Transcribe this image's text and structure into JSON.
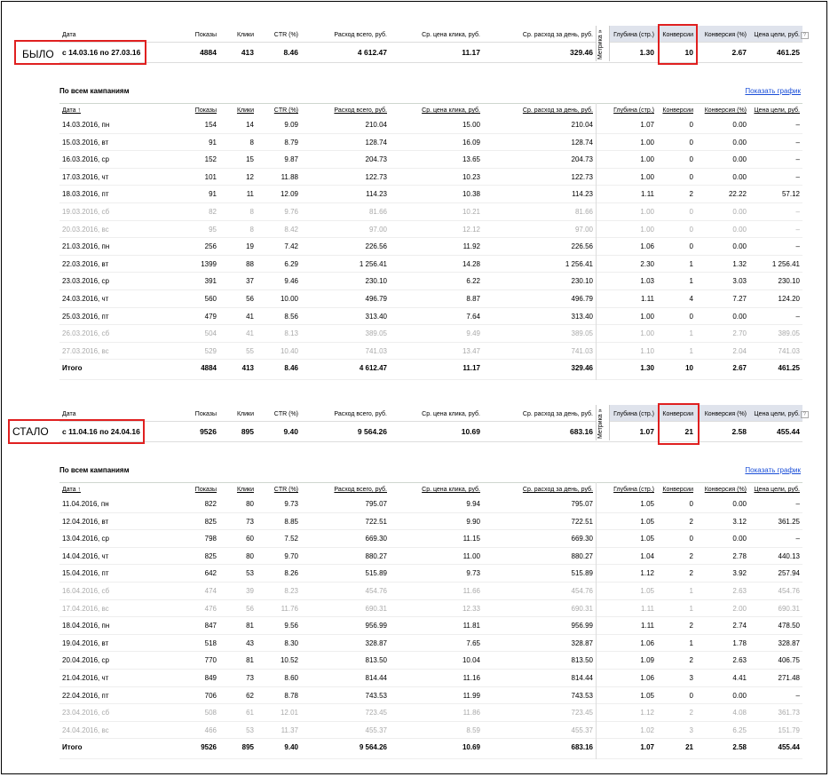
{
  "labels": {
    "before": "БЫЛО",
    "after": "СТАЛО"
  },
  "summary_headers": {
    "date": "Дата",
    "shows": "Показы",
    "clicks": "Клики",
    "ctr": "CTR (%)",
    "spend": "Расход всего, руб.",
    "cpc": "Ср. цена клика, руб.",
    "daily": "Ср. расход за день, руб.",
    "metrika": "Метрика »",
    "depth": "Глубина (стр.)",
    "conv": "Конверсии",
    "conv_pct": "Конверсия (%)",
    "goal_price": "Цена цели, руб.",
    "help": "?"
  },
  "table_headers": {
    "date": "Дата ↑",
    "shows": "Показы",
    "clicks": "Клики",
    "ctr": "CTR (%)",
    "spend": "Расход всего, руб.",
    "cpc": "Ср. цена клика, руб.",
    "daily": "Ср. расход за день, руб.",
    "depth": "Глубина (стр.)",
    "conv": "Конверсии",
    "conv_pct": "Конверсия (%)",
    "goal_price": "Цена цели, руб."
  },
  "section_title": "По всем кампаниям",
  "show_graph": "Показать график",
  "total_label": "Итого",
  "before": {
    "summary": {
      "period": "с 14.03.16 по 27.03.16",
      "shows": "4884",
      "clicks": "413",
      "ctr": "8.46",
      "spend": "4 612.47",
      "cpc": "11.17",
      "daily": "329.46",
      "depth": "1.30",
      "conv": "10",
      "conv_pct": "2.67",
      "goal_price": "461.25"
    },
    "rows": [
      [
        "14.03.2016, пн",
        "154",
        "14",
        "9.09",
        "210.04",
        "15.00",
        "210.04",
        "1.07",
        "0",
        "0.00",
        "–",
        false
      ],
      [
        "15.03.2016, вт",
        "91",
        "8",
        "8.79",
        "128.74",
        "16.09",
        "128.74",
        "1.00",
        "0",
        "0.00",
        "–",
        false
      ],
      [
        "16.03.2016, ср",
        "152",
        "15",
        "9.87",
        "204.73",
        "13.65",
        "204.73",
        "1.00",
        "0",
        "0.00",
        "–",
        false
      ],
      [
        "17.03.2016, чт",
        "101",
        "12",
        "11.88",
        "122.73",
        "10.23",
        "122.73",
        "1.00",
        "0",
        "0.00",
        "–",
        false
      ],
      [
        "18.03.2016, пт",
        "91",
        "11",
        "12.09",
        "114.23",
        "10.38",
        "114.23",
        "1.11",
        "2",
        "22.22",
        "57.12",
        false
      ],
      [
        "19.03.2016, сб",
        "82",
        "8",
        "9.76",
        "81.66",
        "10.21",
        "81.66",
        "1.00",
        "0",
        "0.00",
        "–",
        true
      ],
      [
        "20.03.2016, вс",
        "95",
        "8",
        "8.42",
        "97.00",
        "12.12",
        "97.00",
        "1.00",
        "0",
        "0.00",
        "–",
        true
      ],
      [
        "21.03.2016, пн",
        "256",
        "19",
        "7.42",
        "226.56",
        "11.92",
        "226.56",
        "1.06",
        "0",
        "0.00",
        "–",
        false
      ],
      [
        "22.03.2016, вт",
        "1399",
        "88",
        "6.29",
        "1 256.41",
        "14.28",
        "1 256.41",
        "2.30",
        "1",
        "1.32",
        "1 256.41",
        false
      ],
      [
        "23.03.2016, ср",
        "391",
        "37",
        "9.46",
        "230.10",
        "6.22",
        "230.10",
        "1.03",
        "1",
        "3.03",
        "230.10",
        false
      ],
      [
        "24.03.2016, чт",
        "560",
        "56",
        "10.00",
        "496.79",
        "8.87",
        "496.79",
        "1.11",
        "4",
        "7.27",
        "124.20",
        false
      ],
      [
        "25.03.2016, пт",
        "479",
        "41",
        "8.56",
        "313.40",
        "7.64",
        "313.40",
        "1.00",
        "0",
        "0.00",
        "–",
        false
      ],
      [
        "26.03.2016, сб",
        "504",
        "41",
        "8.13",
        "389.05",
        "9.49",
        "389.05",
        "1.00",
        "1",
        "2.70",
        "389.05",
        true
      ],
      [
        "27.03.2016, вс",
        "529",
        "55",
        "10.40",
        "741.03",
        "13.47",
        "741.03",
        "1.10",
        "1",
        "2.04",
        "741.03",
        true
      ]
    ],
    "total": [
      "4884",
      "413",
      "8.46",
      "4 612.47",
      "11.17",
      "329.46",
      "1.30",
      "10",
      "2.67",
      "461.25"
    ]
  },
  "after": {
    "summary": {
      "period": "с 11.04.16 по 24.04.16",
      "shows": "9526",
      "clicks": "895",
      "ctr": "9.40",
      "spend": "9 564.26",
      "cpc": "10.69",
      "daily": "683.16",
      "depth": "1.07",
      "conv": "21",
      "conv_pct": "2.58",
      "goal_price": "455.44"
    },
    "rows": [
      [
        "11.04.2016, пн",
        "822",
        "80",
        "9.73",
        "795.07",
        "9.94",
        "795.07",
        "1.05",
        "0",
        "0.00",
        "–",
        false
      ],
      [
        "12.04.2016, вт",
        "825",
        "73",
        "8.85",
        "722.51",
        "9.90",
        "722.51",
        "1.05",
        "2",
        "3.12",
        "361.25",
        false
      ],
      [
        "13.04.2016, ср",
        "798",
        "60",
        "7.52",
        "669.30",
        "11.15",
        "669.30",
        "1.05",
        "0",
        "0.00",
        "–",
        false
      ],
      [
        "14.04.2016, чт",
        "825",
        "80",
        "9.70",
        "880.27",
        "11.00",
        "880.27",
        "1.04",
        "2",
        "2.78",
        "440.13",
        false
      ],
      [
        "15.04.2016, пт",
        "642",
        "53",
        "8.26",
        "515.89",
        "9.73",
        "515.89",
        "1.12",
        "2",
        "3.92",
        "257.94",
        false
      ],
      [
        "16.04.2016, сб",
        "474",
        "39",
        "8.23",
        "454.76",
        "11.66",
        "454.76",
        "1.05",
        "1",
        "2.63",
        "454.76",
        true
      ],
      [
        "17.04.2016, вс",
        "476",
        "56",
        "11.76",
        "690.31",
        "12.33",
        "690.31",
        "1.11",
        "1",
        "2.00",
        "690.31",
        true
      ],
      [
        "18.04.2016, пн",
        "847",
        "81",
        "9.56",
        "956.99",
        "11.81",
        "956.99",
        "1.11",
        "2",
        "2.74",
        "478.50",
        false
      ],
      [
        "19.04.2016, вт",
        "518",
        "43",
        "8.30",
        "328.87",
        "7.65",
        "328.87",
        "1.06",
        "1",
        "1.78",
        "328.87",
        false
      ],
      [
        "20.04.2016, ср",
        "770",
        "81",
        "10.52",
        "813.50",
        "10.04",
        "813.50",
        "1.09",
        "2",
        "2.63",
        "406.75",
        false
      ],
      [
        "21.04.2016, чт",
        "849",
        "73",
        "8.60",
        "814.44",
        "11.16",
        "814.44",
        "1.06",
        "3",
        "4.41",
        "271.48",
        false
      ],
      [
        "22.04.2016, пт",
        "706",
        "62",
        "8.78",
        "743.53",
        "11.99",
        "743.53",
        "1.05",
        "0",
        "0.00",
        "–",
        false
      ],
      [
        "23.04.2016, сб",
        "508",
        "61",
        "12.01",
        "723.45",
        "11.86",
        "723.45",
        "1.12",
        "2",
        "4.08",
        "361.73",
        true
      ],
      [
        "24.04.2016, вс",
        "466",
        "53",
        "11.37",
        "455.37",
        "8.59",
        "455.37",
        "1.02",
        "3",
        "6.25",
        "151.79",
        true
      ]
    ],
    "total": [
      "9526",
      "895",
      "9.40",
      "9 564.26",
      "10.69",
      "683.16",
      "1.07",
      "21",
      "2.58",
      "455.44"
    ]
  }
}
